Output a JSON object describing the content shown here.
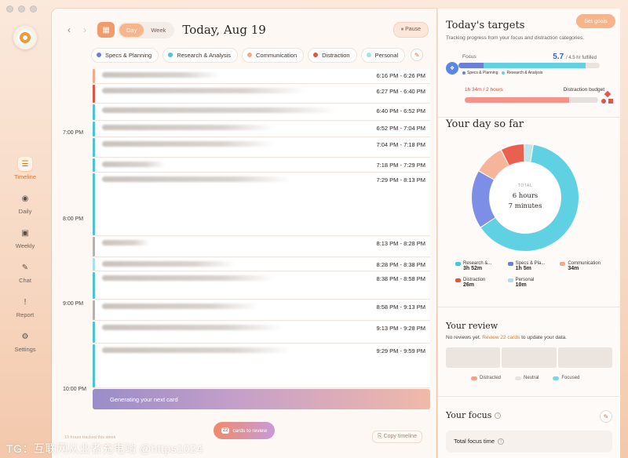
{
  "nav": {
    "items": [
      {
        "label": "Timeline",
        "icon": "timeline-icon",
        "glyph": "☰",
        "active": true
      },
      {
        "label": "Daily",
        "icon": "daily-icon",
        "glyph": "◉",
        "active": false
      },
      {
        "label": "Weekly",
        "icon": "weekly-icon",
        "glyph": "▣",
        "active": false
      },
      {
        "label": "Chat",
        "icon": "chat-icon",
        "glyph": "✎",
        "active": false
      },
      {
        "label": "Report",
        "icon": "report-icon",
        "glyph": "!",
        "active": false
      },
      {
        "label": "Settings",
        "icon": "gear-icon",
        "glyph": "⚙",
        "active": false
      }
    ]
  },
  "header": {
    "view_day": "Day",
    "view_week": "Week",
    "date": "Today, Aug 19",
    "pause_label": "Pause",
    "pause_glyph": "⏸"
  },
  "categories": [
    {
      "label": "Specs & Planning",
      "color": "#6b7fd9"
    },
    {
      "label": "Research & Analysis",
      "color": "#4fc3d6"
    },
    {
      "label": "Communication",
      "color": "#f3a888"
    },
    {
      "label": "Distraction",
      "color": "#e05540"
    },
    {
      "label": "Personal",
      "color": "#a9dfe8"
    }
  ],
  "timeline": {
    "hours": [
      "7:00 PM",
      "8:00 PM",
      "9:00 PM",
      "10:00 PM"
    ],
    "entries": [
      {
        "time": "6:16 PM - 6:26 PM",
        "color": "#f3a888"
      },
      {
        "time": "6:27 PM - 6:40 PM",
        "color": "#e05540"
      },
      {
        "time": "6:40 PM - 6:52 PM",
        "color": "#4fc3d6"
      },
      {
        "time": "6:52 PM - 7:04 PM",
        "color": "#4fc3d6"
      },
      {
        "time": "7:04 PM - 7:18 PM",
        "color": "#4fc3d6"
      },
      {
        "time": "7:18 PM - 7:29 PM",
        "color": "#4fc3d6"
      },
      {
        "time": "7:29 PM - 8:13 PM",
        "color": "#4fc3d6"
      },
      {
        "time": "8:13 PM - 8:28 PM",
        "color": "#b8b3af"
      },
      {
        "time": "8:28 PM - 8:38 PM",
        "color": "#a9dfe8"
      },
      {
        "time": "8:38 PM - 8:58 PM",
        "color": "#4fc3d6"
      },
      {
        "time": "8:58 PM - 9:13 PM",
        "color": "#b8b3af"
      },
      {
        "time": "9:13 PM - 9:28 PM",
        "color": "#4fc3d6"
      },
      {
        "time": "9:29 PM - 9:59 PM",
        "color": "#4fc3d6"
      }
    ],
    "generating_label": "Generating your next card",
    "review_count": "22",
    "review_label": "cards to review",
    "copy_label": "Copy timeline",
    "faint_note": "19 hours tracked this week"
  },
  "targets": {
    "title": "Today's targets",
    "set_goals": "Set goals",
    "subtitle": "Tracking progress from your focus and distraction categories.",
    "focus_label": "Focus",
    "focus_value": "5.7",
    "focus_target": "/ 4.5 hr fulfilled",
    "focus_legend": [
      "Specs & Planning",
      "Research & Analysis"
    ],
    "distraction_value": "1h 34m / 2 hours",
    "distraction_label": "Distraction budget",
    "distraction_fraction": 0.78
  },
  "day_so_far": {
    "title": "Your day so far",
    "total_label": "TOTAL",
    "total_hours": "6 hours",
    "total_minutes": "7 minutes",
    "legend": [
      {
        "label": "Research &...",
        "value": "3h 52m",
        "color": "#4fc3d6"
      },
      {
        "label": "Speсs & Pla...",
        "value": "1h 5m",
        "color": "#6b7fd9"
      },
      {
        "label": "Communication",
        "value": "34m",
        "color": "#f3a888"
      },
      {
        "label": "Distraction",
        "value": "26m",
        "color": "#e05540"
      },
      {
        "label": "Personal",
        "value": "10m",
        "color": "#a9dfe8"
      }
    ]
  },
  "chart_data": {
    "type": "pie",
    "categories": [
      "Research & Analysis",
      "Specs & Planning",
      "Communication",
      "Distraction",
      "Personal"
    ],
    "values": [
      232,
      65,
      34,
      26,
      10
    ],
    "colors": [
      "#5fd1e2",
      "#7d8ee6",
      "#f6b49a",
      "#e9604f",
      "#bfe6ec"
    ]
  },
  "review": {
    "title": "Your review",
    "text_before": "No reviews yet.",
    "link": "Review 22 cards",
    "text_after": "to update your data.",
    "legend": [
      {
        "label": "Distracted",
        "color": "#f3a08a"
      },
      {
        "label": "Neutral",
        "color": "#e8e3df"
      },
      {
        "label": "Focused",
        "color": "#7fd6e3"
      }
    ]
  },
  "focus_section": {
    "title": "Your focus",
    "total_label": "Total focus time"
  },
  "watermark": "TG：互联网从业者充电站 @https1024"
}
